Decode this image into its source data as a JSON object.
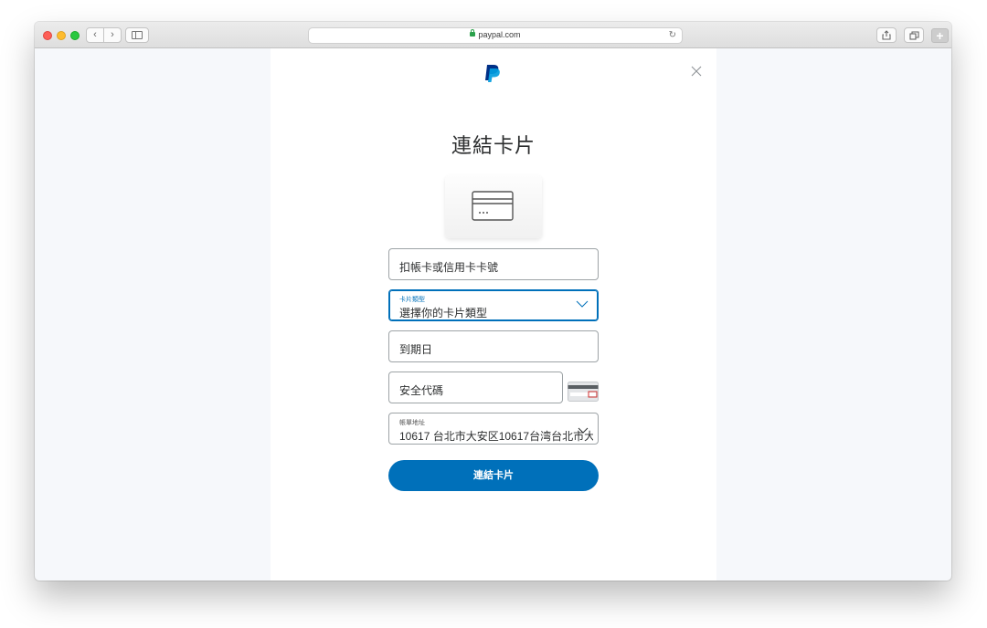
{
  "browser": {
    "url": "paypal.com",
    "new_tab_label": "+"
  },
  "dialog": {
    "title": "連結卡片",
    "fields": {
      "card_number": {
        "label": "扣帳卡或信用卡卡號"
      },
      "card_type": {
        "label": "卡片類型",
        "value": "選擇你的卡片類型"
      },
      "expiry": {
        "label": "到期日"
      },
      "security_code": {
        "label": "安全代碼"
      },
      "billing_address": {
        "label": "帳單地址",
        "value": "10617 台北市大安区10617台湾台北市大安"
      }
    },
    "submit_label": "連結卡片"
  },
  "colors": {
    "brand_blue": "#0070ba",
    "paypal_dark": "#003087",
    "paypal_light": "#009cde"
  }
}
